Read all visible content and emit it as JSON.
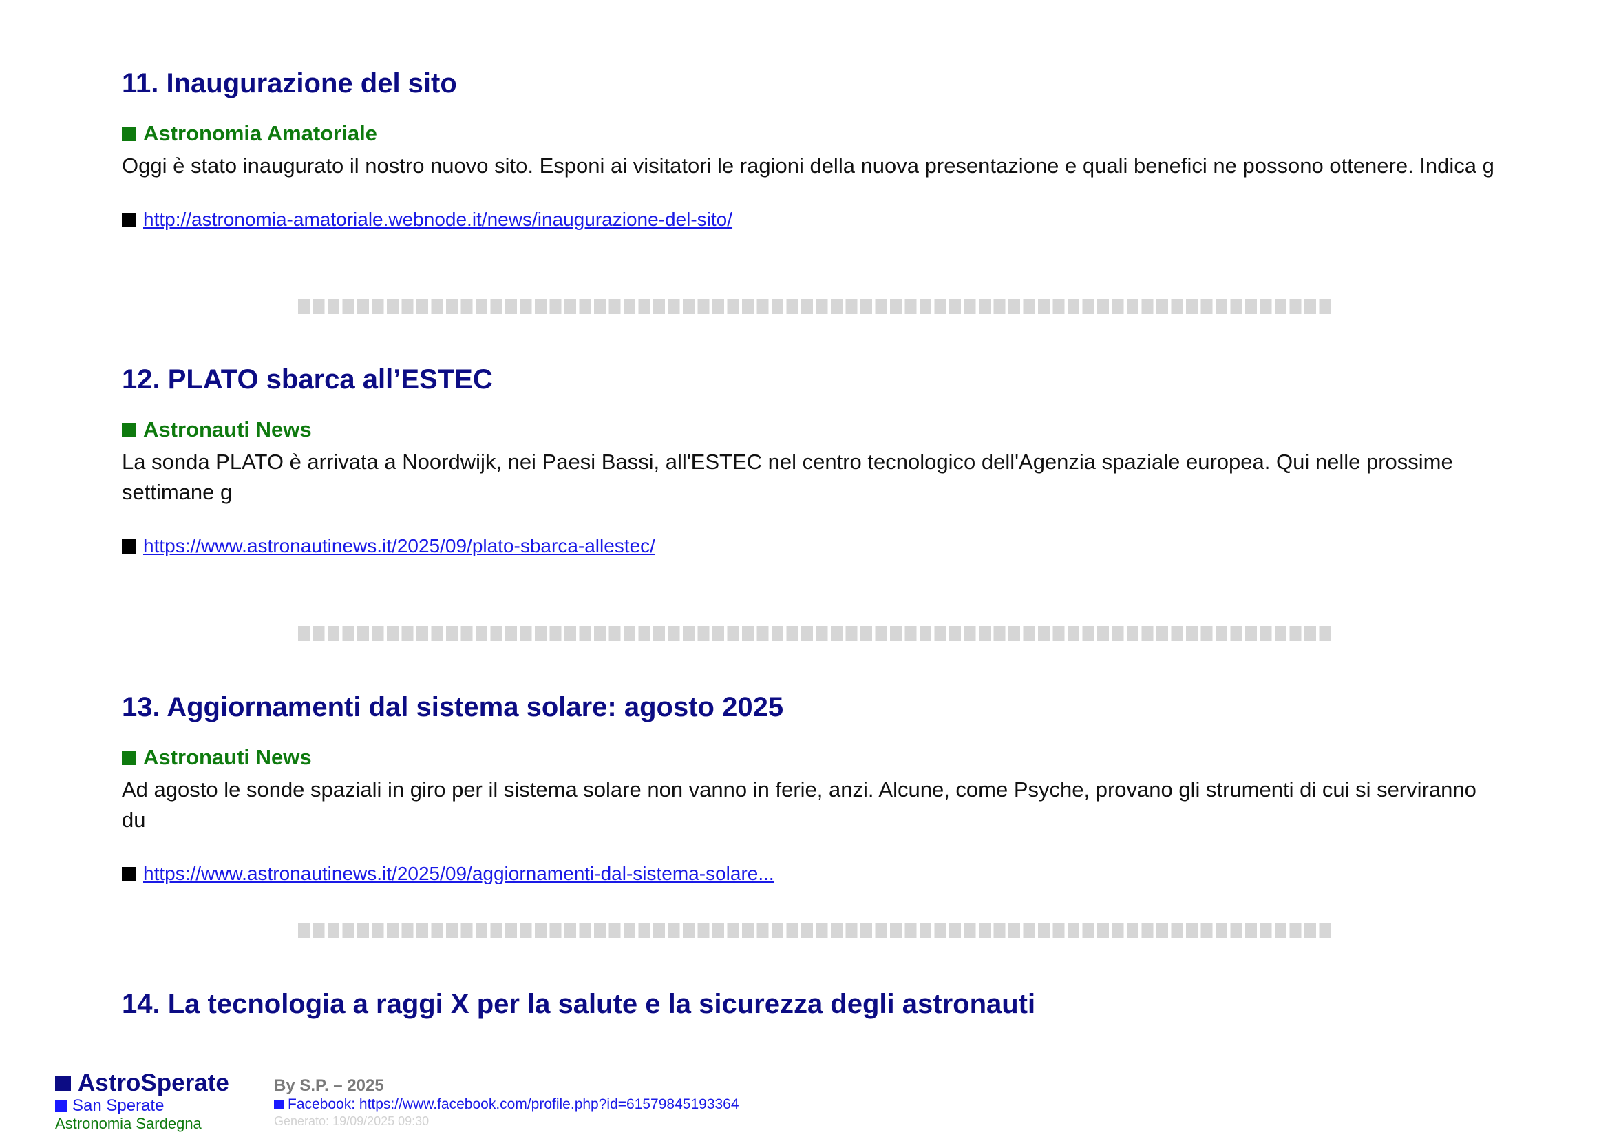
{
  "articles": [
    {
      "title": "11. Inaugurazione del sito",
      "source": "Astronomia Amatoriale",
      "summary": "Oggi è stato inaugurato il nostro nuovo sito. Esponi ai visitatori le ragioni della nuova presentazione e quali benefici ne possono ottenere. Indica g",
      "link": "http://astronomia-amatoriale.webnode.it/news/inaugurazione-del-sito/"
    },
    {
      "title": "12. PLATO sbarca all’ESTEC",
      "source": "Astronauti News",
      "summary": "La sonda PLATO è arrivata a Noordwijk, nei Paesi Bassi, all'ESTEC nel centro tecnologico dell'Agenzia spaziale europea. Qui nelle prossime settimane g",
      "link": "https://www.astronautinews.it/2025/09/plato-sbarca-allestec/"
    },
    {
      "title": "13. Aggiornamenti dal sistema solare: agosto 2025",
      "source": "Astronauti News",
      "summary": "Ad agosto le sonde spaziali in giro per il sistema solare non vanno in ferie, anzi. Alcune, come Psyche, provano gli strumenti di cui si serviranno du",
      "link": "https://www.astronautinews.it/2025/09/aggiornamenti-dal-sistema-solare..."
    },
    {
      "title": "14. La tecnologia a raggi X per la salute e la sicurezza degli astronauti"
    }
  ],
  "footer": {
    "brand": "AstroSperate",
    "town": "San Sperate",
    "subtitle": "Astronomia Sardegna",
    "by": "By S.P. – 2025",
    "facebook": "Facebook: https://www.facebook.com/profile.php?id=61579845193364",
    "generated": "Generato: 19/09/2025 09:30"
  },
  "colors": {
    "title": "#0c0c84",
    "source": "#0e7a0e",
    "link": "#1a1ae6",
    "divider": "#d6d6d6"
  }
}
